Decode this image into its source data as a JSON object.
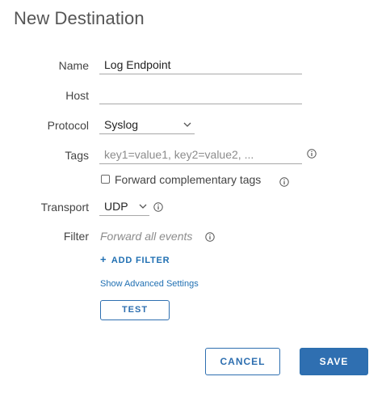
{
  "dialog": {
    "title": "New Destination"
  },
  "form": {
    "name": {
      "label": "Name",
      "value": "Log Endpoint"
    },
    "host": {
      "label": "Host",
      "value": ""
    },
    "protocol": {
      "label": "Protocol",
      "value": "Syslog"
    },
    "tags": {
      "label": "Tags",
      "placeholder": "key1=value1, key2=value2, ..."
    },
    "forward_tags": {
      "label": "Forward complementary tags",
      "checked": false
    },
    "transport": {
      "label": "Transport",
      "value": "UDP"
    },
    "filter": {
      "label": "Filter",
      "value": "Forward all events"
    },
    "add_filter": {
      "icon": "+",
      "label": "ADD FILTER"
    },
    "advanced": {
      "label": "Show Advanced Settings"
    },
    "test": {
      "label": "TEST"
    }
  },
  "footer": {
    "cancel_label": "CANCEL",
    "save_label": "SAVE"
  },
  "colors": {
    "accent": "#2f6fb1",
    "link": "#1f6fb2",
    "placeholder": "#8c8c8c",
    "underline": "#a8a8a8"
  },
  "icons": {
    "info": "info-circle-icon",
    "chevron": "chevron-down-icon",
    "plus": "plus-icon"
  }
}
